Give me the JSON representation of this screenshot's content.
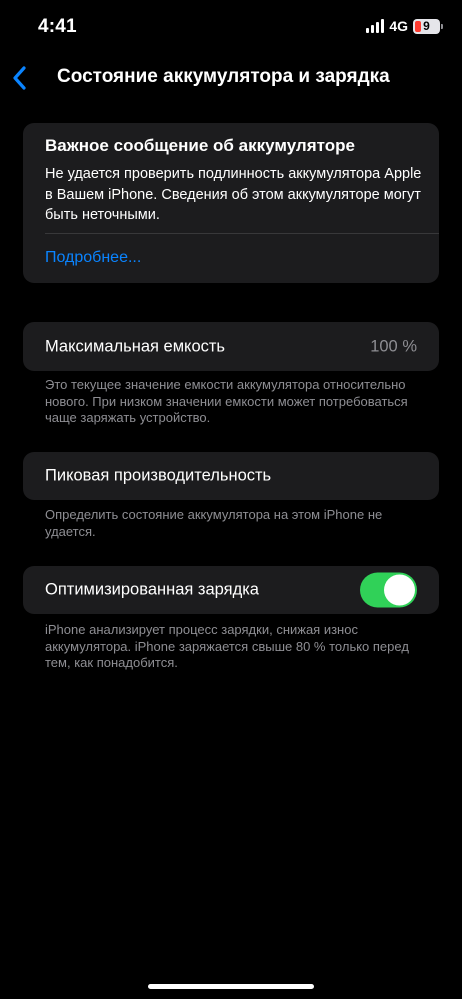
{
  "status_bar": {
    "time": "4:41",
    "network": "4G",
    "battery_level": "9",
    "battery_color": "#ff3b30"
  },
  "nav": {
    "back_icon": "chevron-left-icon",
    "title": "Состояние аккумулятора и зарядка"
  },
  "alert": {
    "title": "Важное сообщение об аккумуляторе",
    "body": "Не удается проверить подлинность аккумулятора Apple в Вашем iPhone. Сведения об этом аккумуляторе могут быть неточными.",
    "link": "Подробнее..."
  },
  "max_capacity": {
    "label": "Максимальная емкость",
    "value": "100 %",
    "footnote": "Это текущее значение емкости аккумулятора относительно нового. При низком значении емкости может потребоваться чаще заряжать устройство."
  },
  "peak_performance": {
    "label": "Пиковая производительность",
    "footnote": "Определить состояние аккумулятора на этом iPhone не удается."
  },
  "optimized_charging": {
    "label": "Оптимизированная зарядка",
    "enabled": true,
    "toggle_color": "#30d158",
    "footnote": "iPhone анализирует процесс зарядки, снижая износ аккумулятора. iPhone заряжается свыше 80 % только перед тем, как понадобится."
  },
  "colors": {
    "background": "#000000",
    "card": "#1c1c1e",
    "accent": "#0a84ff",
    "secondary_text": "#8e8e93"
  }
}
